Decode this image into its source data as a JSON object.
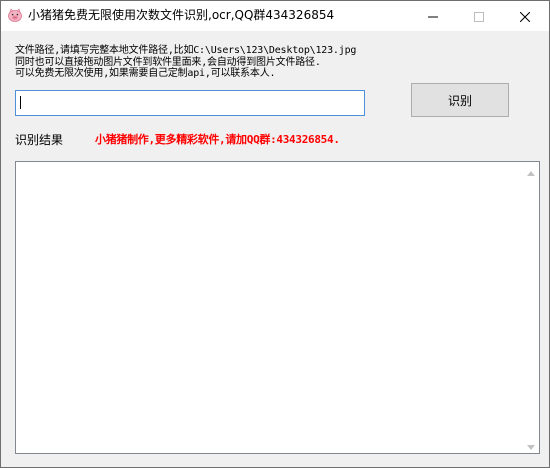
{
  "window": {
    "title": "小猪猪免费无限使用次数文件识别,ocr,QQ群434326854"
  },
  "instructions": {
    "line1": "文件路径,请填写完整本地文件路径,比如C:\\Users\\123\\Desktop\\123.jpg",
    "line2": "同时也可以直接拖动图片文件到软件里面来,会自动得到图片文件路径.",
    "line3": "可以免费无限次使用,如果需要自己定制api,可以联系本人."
  },
  "path_input": {
    "value": ""
  },
  "recognize_button": {
    "label": "识别"
  },
  "result": {
    "label": "识别结果",
    "promo": "小猪猪制作,更多精彩软件,请加QQ群:434326854.",
    "text": ""
  },
  "icons": {
    "app": "pig-icon",
    "minimize": "minimize-icon",
    "maximize": "maximize-icon",
    "close": "close-icon"
  },
  "colors": {
    "promo_text": "#ff0000",
    "input_border": "#4f8fd6"
  }
}
